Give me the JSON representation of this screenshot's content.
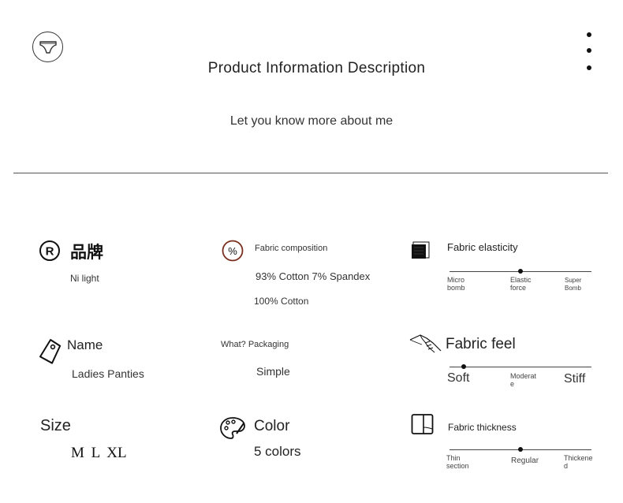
{
  "header": {
    "title": "Product Information Description",
    "subtitle": "Let you know more about me"
  },
  "brand": {
    "label": "品牌",
    "value": "Ni light"
  },
  "fabric_composition": {
    "label": "Fabric composition",
    "values": [
      "93% Cotton 7% Spandex",
      "100% Cotton"
    ]
  },
  "fabric_elasticity": {
    "label": "Fabric elasticity",
    "ticks": [
      "Micro\nbomb",
      "Elastic\nforce",
      "Super\nBomb"
    ],
    "level": 0.5
  },
  "name": {
    "label": "Name",
    "value": "Ladies Panties"
  },
  "packaging": {
    "label": "What? Packaging",
    "value": "Simple"
  },
  "fabric_feel": {
    "label": "Fabric feel",
    "ticks": [
      "Soft",
      "Moderat\ne",
      "Stiff"
    ],
    "level": 0.1
  },
  "size": {
    "label": "Size",
    "value": "M L XL"
  },
  "color": {
    "label": "Color",
    "value": "5 colors"
  },
  "fabric_thickness": {
    "label": "Fabric thickness",
    "ticks": [
      "Thin\nsection",
      "Regular",
      "Thickene\nd"
    ],
    "level": 0.5
  },
  "icons": [
    "panties-icon",
    "menu-dots-icon",
    "registered-icon",
    "percent-icon",
    "fabric-swatch-icon",
    "tag-icon",
    "hand-feel-icon",
    "palette-icon",
    "book-icon"
  ]
}
